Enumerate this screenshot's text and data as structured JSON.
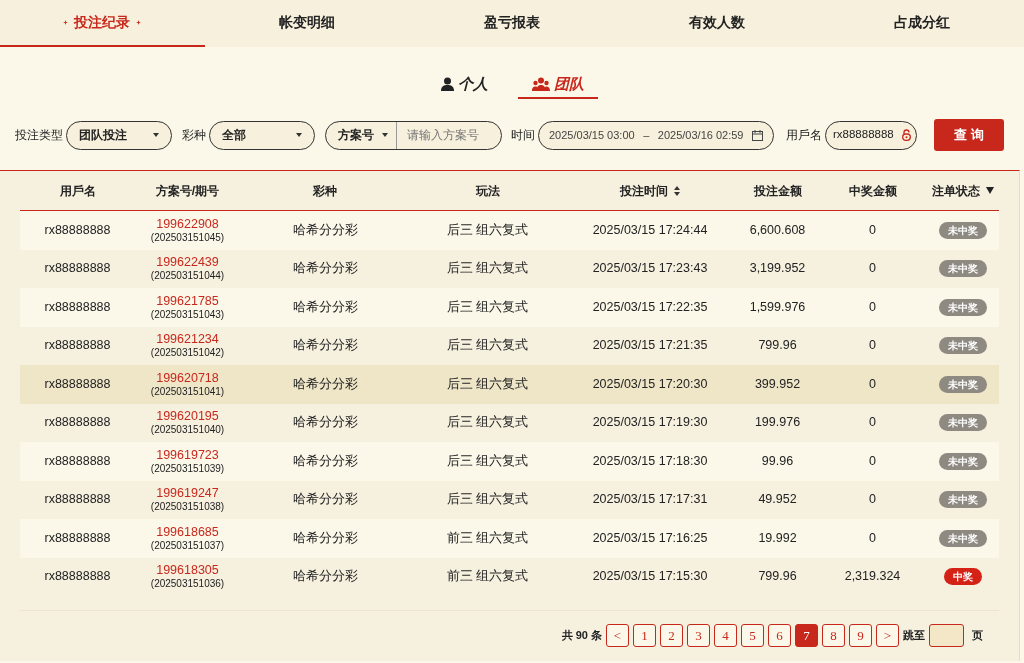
{
  "tabs": [
    {
      "label": "投注纪录",
      "selected": true
    },
    {
      "label": "帐变明细",
      "selected": false
    },
    {
      "label": "盈亏报表",
      "selected": false
    },
    {
      "label": "有效人数",
      "selected": false
    },
    {
      "label": "占成分红",
      "selected": false
    }
  ],
  "scope_tabs": [
    {
      "label": "个人",
      "kind": "person",
      "selected": false
    },
    {
      "label": "团队",
      "kind": "team",
      "selected": true
    }
  ],
  "filters": {
    "bet_type_label": "投注类型",
    "bet_type": "团队投注",
    "lottery_label": "彩种",
    "lottery": "全部",
    "plan_select": "方案号",
    "plan_placeholder": "请输入方案号",
    "time_label": "时间",
    "time_start": "2025/03/15 03:00",
    "time_sep": "–",
    "time_end": "2025/03/16 02:59",
    "user_label": "用戶名",
    "user": "rx88888888",
    "query_button": "查 询"
  },
  "table": {
    "columns": [
      {
        "label": "用戶名",
        "kind": "plain"
      },
      {
        "label": "方案号/期号",
        "kind": "plain"
      },
      {
        "label": "彩种",
        "kind": "plain"
      },
      {
        "label": "玩法",
        "kind": "plain"
      },
      {
        "label": "投注时间",
        "kind": "sortable"
      },
      {
        "label": "投注金额",
        "kind": "plain"
      },
      {
        "label": "中奖金额",
        "kind": "plain"
      },
      {
        "label": "注单状态",
        "kind": "filterable"
      }
    ],
    "rows": [
      {
        "user": "rx88888888",
        "plan": "199622908",
        "issue": "(202503151045)",
        "lottery": "哈希分分彩",
        "play": "后三 组六复式",
        "time": "2025/03/15 17:24:44",
        "amount": "6,600.608",
        "win": "0",
        "status": "未中奖",
        "won": false,
        "selected": false
      },
      {
        "user": "rx88888888",
        "plan": "199622439",
        "issue": "(202503151044)",
        "lottery": "哈希分分彩",
        "play": "后三 组六复式",
        "time": "2025/03/15 17:23:43",
        "amount": "3,199.952",
        "win": "0",
        "status": "未中奖",
        "won": false,
        "selected": false
      },
      {
        "user": "rx88888888",
        "plan": "199621785",
        "issue": "(202503151043)",
        "lottery": "哈希分分彩",
        "play": "后三 组六复式",
        "time": "2025/03/15 17:22:35",
        "amount": "1,599.976",
        "win": "0",
        "status": "未中奖",
        "won": false,
        "selected": false
      },
      {
        "user": "rx88888888",
        "plan": "199621234",
        "issue": "(202503151042)",
        "lottery": "哈希分分彩",
        "play": "后三 组六复式",
        "time": "2025/03/15 17:21:35",
        "amount": "799.96",
        "win": "0",
        "status": "未中奖",
        "won": false,
        "selected": false
      },
      {
        "user": "rx88888888",
        "plan": "199620718",
        "issue": "(202503151041)",
        "lottery": "哈希分分彩",
        "play": "后三 组六复式",
        "time": "2025/03/15 17:20:30",
        "amount": "399.952",
        "win": "0",
        "status": "未中奖",
        "won": false,
        "selected": true
      },
      {
        "user": "rx88888888",
        "plan": "199620195",
        "issue": "(202503151040)",
        "lottery": "哈希分分彩",
        "play": "后三 组六复式",
        "time": "2025/03/15 17:19:30",
        "amount": "199.976",
        "win": "0",
        "status": "未中奖",
        "won": false,
        "selected": false
      },
      {
        "user": "rx88888888",
        "plan": "199619723",
        "issue": "(202503151039)",
        "lottery": "哈希分分彩",
        "play": "后三 组六复式",
        "time": "2025/03/15 17:18:30",
        "amount": "99.96",
        "win": "0",
        "status": "未中奖",
        "won": false,
        "selected": false
      },
      {
        "user": "rx88888888",
        "plan": "199619247",
        "issue": "(202503151038)",
        "lottery": "哈希分分彩",
        "play": "后三 组六复式",
        "time": "2025/03/15 17:17:31",
        "amount": "49.952",
        "win": "0",
        "status": "未中奖",
        "won": false,
        "selected": false
      },
      {
        "user": "rx88888888",
        "plan": "199618685",
        "issue": "(202503151037)",
        "lottery": "哈希分分彩",
        "play": "前三 组六复式",
        "time": "2025/03/15 17:16:25",
        "amount": "19.992",
        "win": "0",
        "status": "未中奖",
        "won": false,
        "selected": false
      },
      {
        "user": "rx88888888",
        "plan": "199618305",
        "issue": "(202503151036)",
        "lottery": "哈希分分彩",
        "play": "前三 组六复式",
        "time": "2025/03/15 17:15:30",
        "amount": "799.96",
        "win": "2,319.324",
        "status": "中奖",
        "won": true,
        "selected": false
      }
    ]
  },
  "pagination": {
    "total": "共 90 条",
    "prev": "<",
    "pages": [
      {
        "label": "1",
        "selected": false
      },
      {
        "label": "2",
        "selected": false
      },
      {
        "label": "3",
        "selected": false
      },
      {
        "label": "4",
        "selected": false
      },
      {
        "label": "5",
        "selected": false
      },
      {
        "label": "6",
        "selected": false
      },
      {
        "label": "7",
        "selected": true
      },
      {
        "label": "8",
        "selected": false
      },
      {
        "label": "9",
        "selected": false
      }
    ],
    "next": ">",
    "jump_label": "跳至",
    "page_suffix": "页"
  }
}
